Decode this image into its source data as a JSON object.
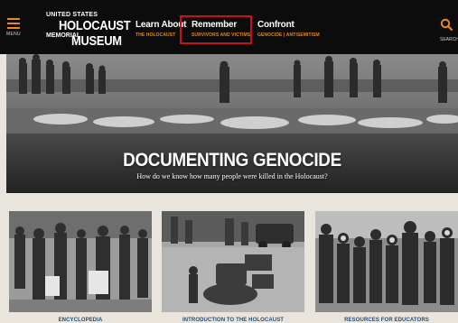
{
  "header": {
    "menu_label": "MENU",
    "logo": {
      "line1": "UNITED STATES",
      "line2": "HOLOCAUST",
      "line3": "MEMORIAL",
      "line4": "MUSEUM"
    },
    "nav": [
      {
        "title": "Learn About",
        "sub": "THE HOLOCAUST"
      },
      {
        "title": "Remember",
        "sub": "SURVIVORS AND VICTIMS"
      },
      {
        "title": "Confront",
        "sub": "GENOCIDE  |  ANTISEMITISM"
      }
    ],
    "search_label": "SEARCH"
  },
  "hero": {
    "title": "DOCUMENTING GENOCIDE",
    "subtitle": "How do we know how many people were killed in the Holocaust?"
  },
  "cards": [
    {
      "label": "ENCYCLOPEDIA"
    },
    {
      "label": "INTRODUCTION TO THE HOLOCAUST"
    },
    {
      "label": "RESOURCES FOR EDUCATORS"
    }
  ],
  "colors": {
    "header_bg": "#0c0c0c",
    "accent_orange": "#e8871e",
    "highlight_red": "#c8101e",
    "link_blue": "#1f4e79",
    "page_bg": "#e9e5dc"
  }
}
